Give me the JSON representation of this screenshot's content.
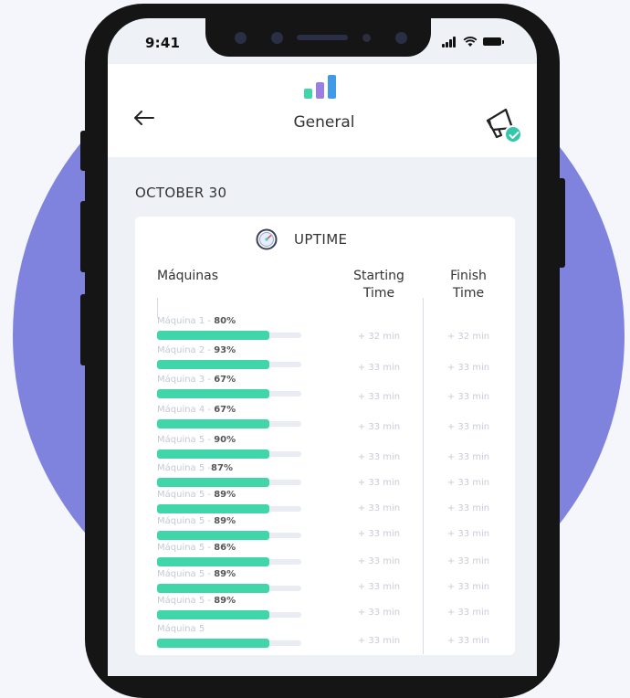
{
  "status_bar": {
    "time": "9:41"
  },
  "header": {
    "title": "General",
    "back_icon": "arrow-left-icon",
    "action_icon": "megaphone-icon"
  },
  "date_label": "OCTOBER 30",
  "card": {
    "title": "UPTIME",
    "columns": {
      "machines": "Máquinas",
      "starting_line1": "Starting",
      "starting_line2": "Time",
      "finish_line1": "Finish",
      "finish_line2": "Time"
    },
    "rows": [
      {
        "name": "Máquina 1",
        "sep": " - ",
        "pct": "80%",
        "fill": 0.78,
        "start": "+ 32 min",
        "finish": "+ 32 min"
      },
      {
        "name": "Máquina 2",
        "sep": " - ",
        "pct": "93%",
        "fill": 0.78,
        "start": "+ 33 min",
        "finish": "+ 33 min"
      },
      {
        "name": "Máquina 3",
        "sep": " - ",
        "pct": "67%",
        "fill": 0.78,
        "start": "+ 33 min",
        "finish": "+ 33 min"
      },
      {
        "name": "Máquina 4",
        "sep": " - ",
        "pct": "67%",
        "fill": 0.78,
        "start": "+ 33 min",
        "finish": "+ 33 min"
      },
      {
        "name": "Máquina 5",
        "sep": " - ",
        "pct": "90%",
        "fill": 0.78,
        "start": "+ 33 min",
        "finish": "+ 33 min"
      },
      {
        "name": "Máquina 5",
        "sep": " -",
        "pct": "87%",
        "fill": 0.78,
        "start": "+ 33 min",
        "finish": "+ 33 min"
      },
      {
        "name": "Máquina 5",
        "sep": " - ",
        "pct": "89%",
        "fill": 0.78,
        "start": "+ 33 min",
        "finish": "+ 33 min"
      },
      {
        "name": "Máquina 5",
        "sep": " - ",
        "pct": "89%",
        "fill": 0.78,
        "start": "+ 33 min",
        "finish": "+ 33 min"
      },
      {
        "name": "Máquina 5",
        "sep": " - ",
        "pct": "86%",
        "fill": 0.78,
        "start": "+ 33 min",
        "finish": "+ 33 min"
      },
      {
        "name": "Máquina 5",
        "sep": " - ",
        "pct": "89%",
        "fill": 0.78,
        "start": "+ 33 min",
        "finish": "+ 33 min"
      },
      {
        "name": "Máquina 5",
        "sep": " - ",
        "pct": "89%",
        "fill": 0.78,
        "start": "+ 33 min",
        "finish": "+ 33 min"
      },
      {
        "name": "Máquina 5",
        "sep": "",
        "pct": "",
        "fill": 0.78,
        "start": "+ 33 min",
        "finish": "+ 33 min"
      }
    ]
  },
  "colors": {
    "background_circle": "#7f83dd",
    "bar": "#41d6a9",
    "logo_bar1": "#41d6a9",
    "logo_bar2": "#9b7fe0",
    "logo_bar3": "#3f9be8",
    "badge": "#34c7a9"
  }
}
